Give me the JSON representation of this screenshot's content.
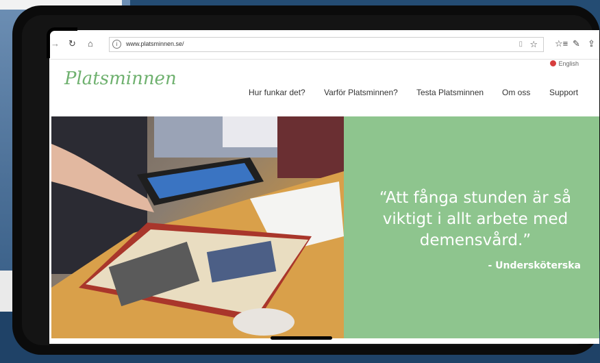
{
  "browser": {
    "url": "www.platsminnen.se/",
    "back_icon": "back-arrow-icon",
    "refresh_icon": "refresh-icon",
    "home_icon": "home-icon"
  },
  "site": {
    "logo_text": "Platsminnen",
    "language_label": "English",
    "nav": [
      "Hur funkar det?",
      "Varför Platsminnen?",
      "Testa Platsminnen",
      "Om oss",
      "Support"
    ]
  },
  "hero": {
    "quote": "“Att fånga stunden är så viktigt i allt arbete med demensvård.”",
    "author": "- Undersköterska"
  },
  "colors": {
    "brand_green": "#6fb16f",
    "panel_green": "#8ec58e",
    "background_blue": "#244c73"
  }
}
